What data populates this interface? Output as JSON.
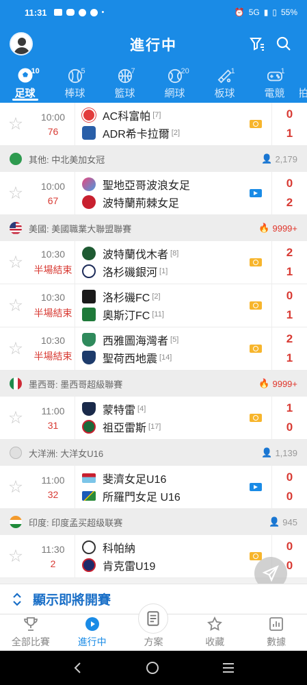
{
  "status_bar": {
    "time": "11:31",
    "network": "5G",
    "battery": "55%"
  },
  "header": {
    "title": "進行中"
  },
  "sports_tabs": [
    {
      "label": "足球",
      "count": "10",
      "icon": "soccer-ball-icon",
      "active": true
    },
    {
      "label": "棒球",
      "count": "5",
      "icon": "baseball-icon",
      "active": false
    },
    {
      "label": "籃球",
      "count": "7",
      "icon": "basketball-icon",
      "active": false
    },
    {
      "label": "網球",
      "count": "20",
      "icon": "tennis-ball-icon",
      "active": false
    },
    {
      "label": "板球",
      "count": "1",
      "icon": "cricket-bat-icon",
      "active": false
    },
    {
      "label": "電競",
      "count": "1",
      "icon": "gamepad-icon",
      "active": false
    },
    {
      "label": "拍",
      "count": "",
      "icon": "racket-icon",
      "active": false
    }
  ],
  "matches": [
    {
      "time": "10:00",
      "minute": "76",
      "home": "AC科富帕",
      "home_rank": "[7]",
      "away": "ADR希卡拉爾",
      "away_rank": "[2]",
      "home_score": "0",
      "away_score": "1",
      "media": "odds"
    },
    {
      "time": "10:00",
      "minute": "67",
      "home": "聖地亞哥波浪女足",
      "home_rank": "",
      "away": "波特蘭荊棘女足",
      "away_rank": "",
      "home_score": "0",
      "away_score": "2",
      "media": "live"
    },
    {
      "time": "10:30",
      "minute": "半場結束",
      "home": "波特蘭伐木者",
      "home_rank": "[8]",
      "away": "洛杉磯銀河",
      "away_rank": "[1]",
      "home_score": "2",
      "away_score": "1",
      "media": "odds"
    },
    {
      "time": "10:30",
      "minute": "半場結束",
      "home": "洛杉磯FC",
      "home_rank": "[2]",
      "away": "奧斯汀FC",
      "away_rank": "[11]",
      "home_score": "0",
      "away_score": "1",
      "media": "odds"
    },
    {
      "time": "10:30",
      "minute": "半場結束",
      "home": "西雅圖海灣者",
      "home_rank": "[5]",
      "away": "聖荷西地震",
      "away_rank": "[14]",
      "home_score": "2",
      "away_score": "1",
      "media": "odds"
    },
    {
      "time": "11:00",
      "minute": "31",
      "home": "蒙特雷",
      "home_rank": "[4]",
      "away": "祖亞雷斯",
      "away_rank": "[17]",
      "home_score": "1",
      "away_score": "0",
      "media": "odds"
    },
    {
      "time": "11:00",
      "minute": "32",
      "home": "斐濟女足U16",
      "home_rank": "",
      "away": "所羅門女足 U16",
      "away_rank": "",
      "home_score": "0",
      "away_score": "0",
      "media": "live"
    },
    {
      "time": "11:30",
      "minute": "2",
      "home": "科帕納",
      "home_rank": "",
      "away": "肯克雷U19",
      "away_rank": "",
      "home_score": "0",
      "away_score": "0",
      "media": "odds"
    }
  ],
  "leagues": [
    {
      "name": "其他: 中北美加女冠",
      "views": "2,179",
      "hot": false
    },
    {
      "name": "美國: 美國職業大聯盟聯賽",
      "views": "9999+",
      "hot": true
    },
    {
      "name": "墨西哥: 墨西哥超級聯賽",
      "views": "9999+",
      "hot": true
    },
    {
      "name": "大洋洲: 大洋女U16",
      "views": "1,139",
      "hot": false
    },
    {
      "name": "印度: 印度孟买超级联赛",
      "views": "945",
      "hot": false
    }
  ],
  "upcoming_label": "顯示即將開賽",
  "bottom_nav": [
    {
      "label": "全部比賽",
      "icon": "trophy-icon"
    },
    {
      "label": "進行中",
      "icon": "play-circle-icon"
    },
    {
      "label": "方案",
      "icon": "document-icon"
    },
    {
      "label": "收藏",
      "icon": "star-icon"
    },
    {
      "label": "數據",
      "icon": "chart-icon"
    }
  ],
  "colors": {
    "primary": "#1a8be6",
    "score_red": "#d83a33",
    "odds_badge": "#f7b52c",
    "link_blue": "#1a6fc7"
  }
}
